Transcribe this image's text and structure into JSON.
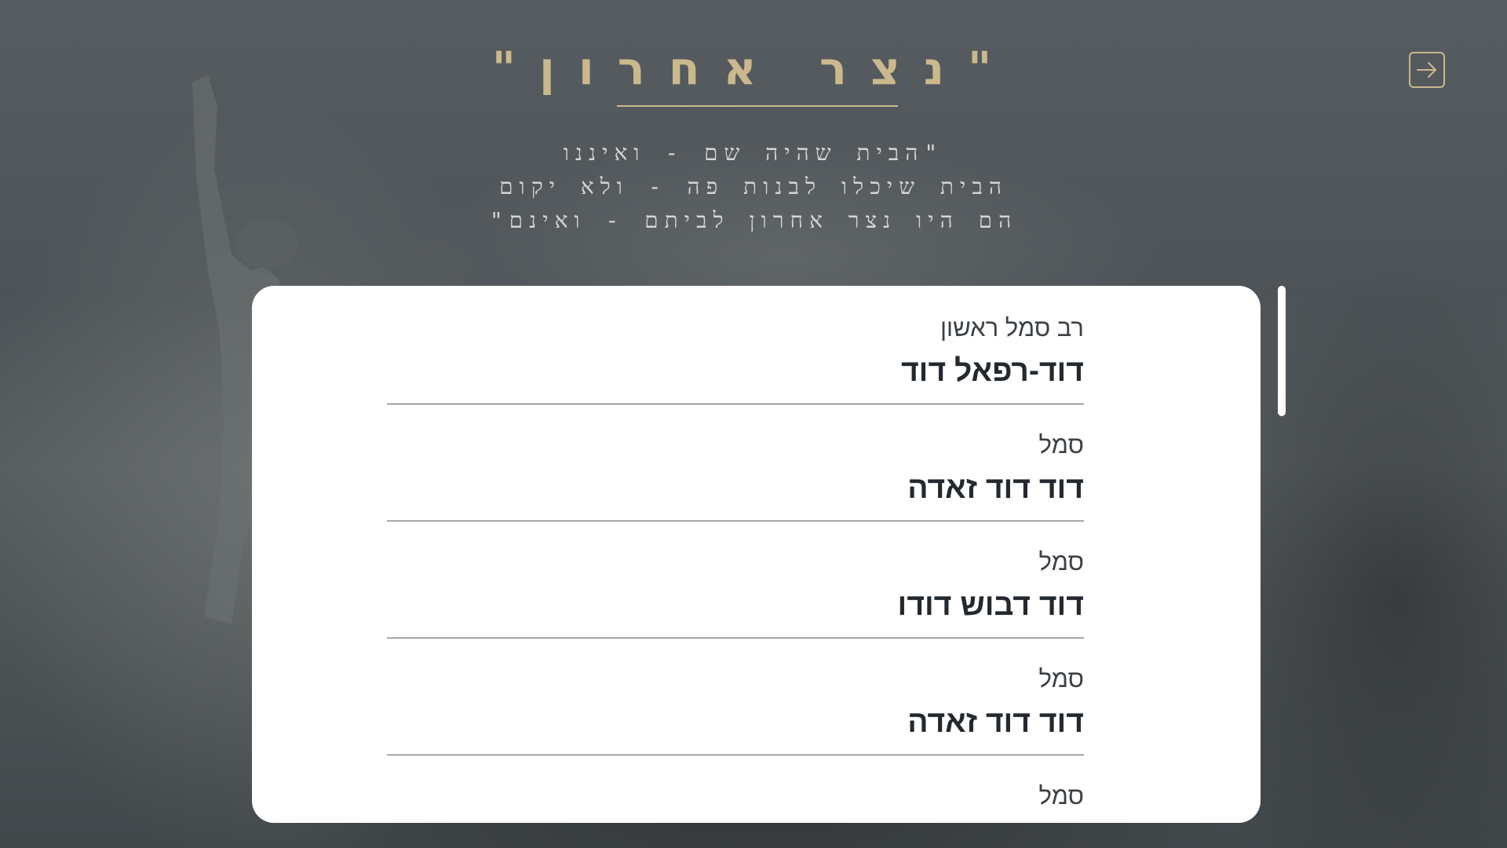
{
  "header": {
    "title": "\"נצר אחרון\"",
    "quote_lines": [
      "\"הבית שהיה שם - ואיננו",
      "הבית שיכלו לבנות פה - ולא יקום",
      "הם היו נצר אחרון לביתם - ואינם\""
    ],
    "back_icon": "arrow-right-icon",
    "accent_color": "#cbb98d"
  },
  "entries": [
    {
      "rank": "רב סמל ראשון",
      "name": "דוד-רפאל דוד"
    },
    {
      "rank": "סמל",
      "name": "דוד דוד זאדה"
    },
    {
      "rank": "סמל",
      "name": "דוד דבוש דודו"
    },
    {
      "rank": "סמל",
      "name": "דוד דוד זאדה"
    },
    {
      "rank": "סמל",
      "name": ""
    }
  ]
}
